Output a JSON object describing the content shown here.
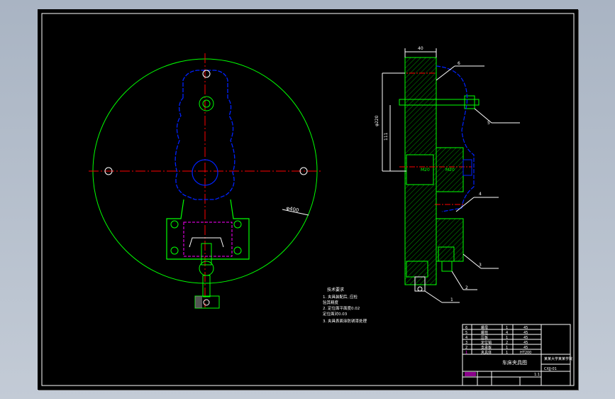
{
  "colors": {
    "background": "#000000",
    "frame": "#ffffff",
    "disc": "#00ff00",
    "centerline": "#ff0000",
    "body": "#0022ff",
    "parts": "#00ff00",
    "hatch": "#00ff00",
    "title_accent": "#ff00ff",
    "dimension": "#ffffff"
  },
  "technical_requirements": {
    "heading": "技术要求",
    "lines": [
      "1. 夹具装配后, 应检",
      "   验其精度",
      "2. 定位面平面度0.02",
      "   定位面对0.03",
      "3. 夹具表面涂防锈漆处理"
    ]
  },
  "title_block": {
    "drawing_title": "车床夹具图",
    "school": "某某大学某某学院",
    "drawing_number": "CXJJ-01",
    "scale_label": "1:1",
    "rows": [
      {
        "no": "6",
        "name": "螺母",
        "qty": "1",
        "material": "45"
      },
      {
        "no": "5",
        "name": "螺栓",
        "qty": "4",
        "material": "45"
      },
      {
        "no": "4",
        "name": "压板",
        "qty": "1",
        "material": "45"
      },
      {
        "no": "3",
        "name": "定位销",
        "qty": "2",
        "material": "45"
      },
      {
        "no": "2",
        "name": "支承板",
        "qty": "1",
        "material": "45"
      },
      {
        "no": "1",
        "name": "夹具体",
        "qty": "1",
        "material": "HT200"
      }
    ]
  },
  "balloons": [
    "6",
    "5",
    "4",
    "3",
    "2",
    "1"
  ],
  "dimensions": {
    "thickness": "40",
    "height_a": "φ220",
    "height_b": "111",
    "diameter": "φ400"
  }
}
